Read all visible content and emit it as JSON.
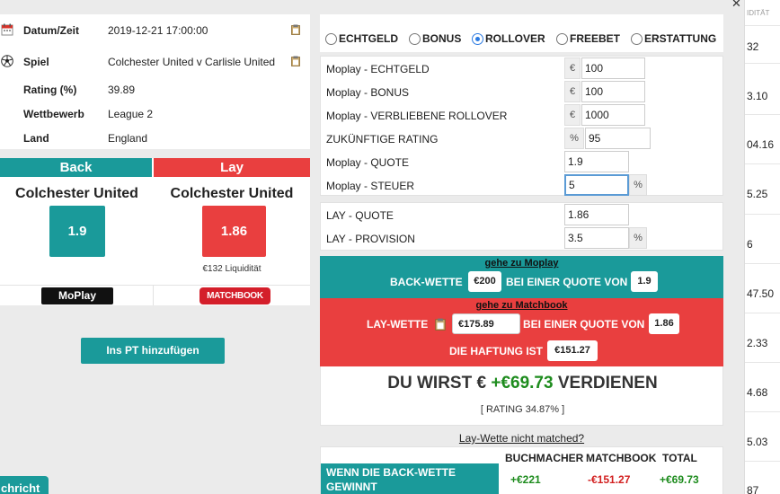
{
  "background_column": {
    "header": "IDITÄT",
    "values": [
      "32",
      "3.10",
      "04.16",
      "5.25",
      "6",
      "47.50",
      "2.33",
      "4.68",
      "5.03",
      "87"
    ]
  },
  "event": {
    "rows": [
      {
        "label": "Datum/Zeit",
        "value": "2019-12-21 17:00:00",
        "icon": "calendar-icon",
        "copy": true
      },
      {
        "label": "Spiel",
        "value": "Colchester United v Carlisle United",
        "icon": "football-icon",
        "copy": true
      },
      {
        "label": "Rating (%)",
        "value": "39.89"
      },
      {
        "label": "Wettbewerb",
        "value": "League 2"
      },
      {
        "label": "Land",
        "value": "England"
      }
    ]
  },
  "back": {
    "header": "Back",
    "team": "Colchester United",
    "odds": "1.9",
    "bookmaker": "MoPlay",
    "color": "#1a9a9a"
  },
  "lay": {
    "header": "Lay",
    "team": "Colchester United",
    "odds": "1.86",
    "liquidity": "€132 Liquidität",
    "exchange": "MATCHBOOK",
    "color": "#e93f3f"
  },
  "add_pt_label": "Ins PT hinzufügen",
  "message_tab_label": "chricht",
  "bet_types": [
    {
      "label": "ECHTGELD",
      "selected": false
    },
    {
      "label": "BONUS",
      "selected": false
    },
    {
      "label": "ROLLOVER",
      "selected": true
    },
    {
      "label": "FREEBET",
      "selected": false
    },
    {
      "label": "ERSTATTUNG",
      "selected": false
    }
  ],
  "moplay_fields": [
    {
      "label": "Moplay - ECHTGELD",
      "prefix": "€",
      "value": "100"
    },
    {
      "label": "Moplay - BONUS",
      "prefix": "€",
      "value": "100"
    },
    {
      "label": "Moplay - VERBLIEBENE ROLLOVER",
      "prefix": "€",
      "value": "1000"
    },
    {
      "label": "ZUKÜNFTIGE RATING",
      "prefix": "%",
      "value": "95"
    },
    {
      "label": "Moplay - QUOTE",
      "value": "1.9"
    },
    {
      "label": "Moplay - STEUER",
      "value": "5",
      "suffix": "%"
    }
  ],
  "lay_fields": [
    {
      "label": "LAY - QUOTE",
      "value": "1.86"
    },
    {
      "label": "LAY - PROVISION",
      "value": "3.5",
      "suffix": "%"
    }
  ],
  "calc": {
    "back_link": "gehe zu Moplay",
    "back_text": "BACK-WETTE",
    "back_stake": "€200",
    "at_odds_text": "BEI EINER QUOTE VON",
    "back_odds": "1.9",
    "lay_link": "gehe zu Matchbook",
    "lay_text": "LAY-WETTE",
    "lay_stake": "€175.89",
    "lay_odds": "1.86",
    "liability_text": "DIE HAFTUNG IST",
    "liability": "€151.27"
  },
  "result": {
    "prefix": "DU WIRST €",
    "amount": "+€69.73",
    "suffix": "VERDIENEN",
    "rating": "[ RATING 34.87% ]"
  },
  "not_matched_link": "Lay-Wette nicht matched?",
  "outcome_table": {
    "headers": [
      "BUCHMACHER",
      "MATCHBOOK",
      "TOTAL"
    ],
    "rows": [
      {
        "label": "WENN DIE BACK-WETTE GEWINNT",
        "bookmaker": "+€221",
        "exchange": "-€151.27",
        "total": "+€69.73"
      }
    ]
  }
}
